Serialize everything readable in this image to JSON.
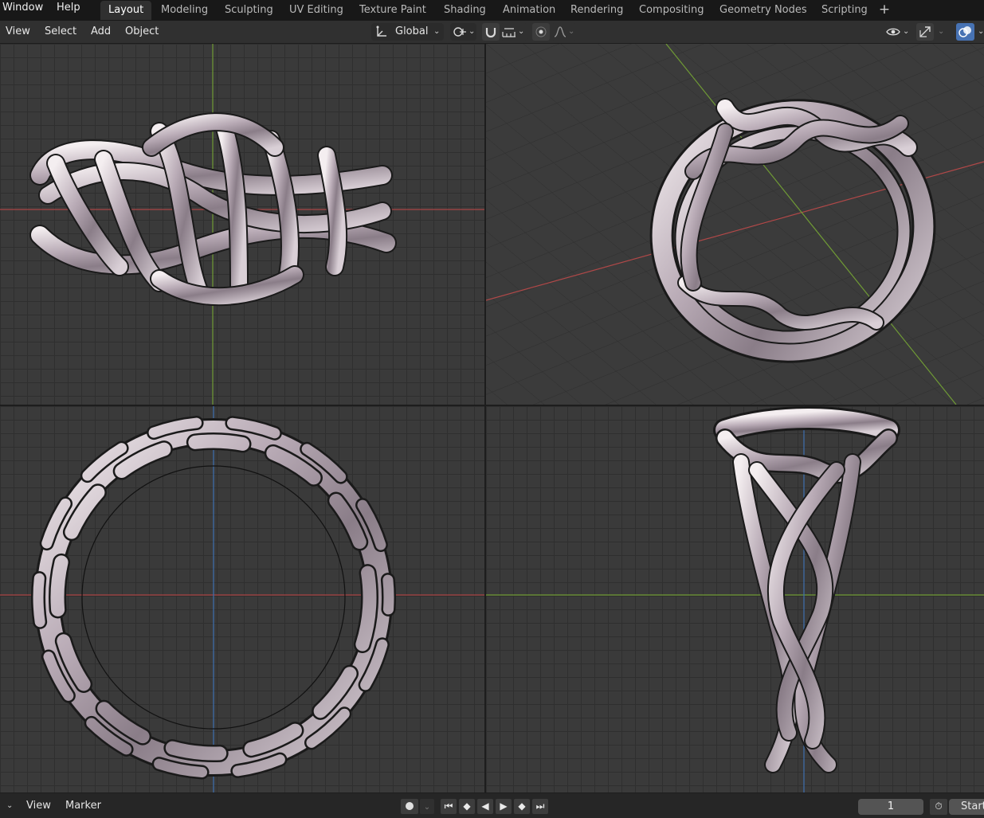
{
  "top_menu": {
    "window": "Window",
    "help": "Help"
  },
  "workspaces": [
    "Layout",
    "Modeling",
    "Sculpting",
    "UV Editing",
    "Texture Paint",
    "Shading",
    "Animation",
    "Rendering",
    "Compositing",
    "Geometry Nodes",
    "Scripting"
  ],
  "active_workspace": "Layout",
  "header": {
    "menus": [
      "View",
      "Select",
      "Add",
      "Object"
    ],
    "orientation": "Global"
  },
  "icons": {
    "add_workspace": "plus-icon",
    "transform_orientation": "axes-icon",
    "pivot": "pivot-icon",
    "snap": "magnet-icon",
    "snap_target": "increment-icon",
    "proportional": "proportional-dot-icon",
    "falloff": "falloff-curve-icon",
    "visibility": "eye-icon",
    "gizmo": "gizmo-icon",
    "overlay": "overlay-icon"
  },
  "timeline": {
    "menus": [
      "View",
      "Marker"
    ],
    "current_frame": "1",
    "start_label": "Start"
  },
  "colors": {
    "accent_blue": "#4772b3",
    "x_axis": "#c84c4c",
    "y_axis": "#7ba63b",
    "z_axis": "#3d6fb0"
  }
}
